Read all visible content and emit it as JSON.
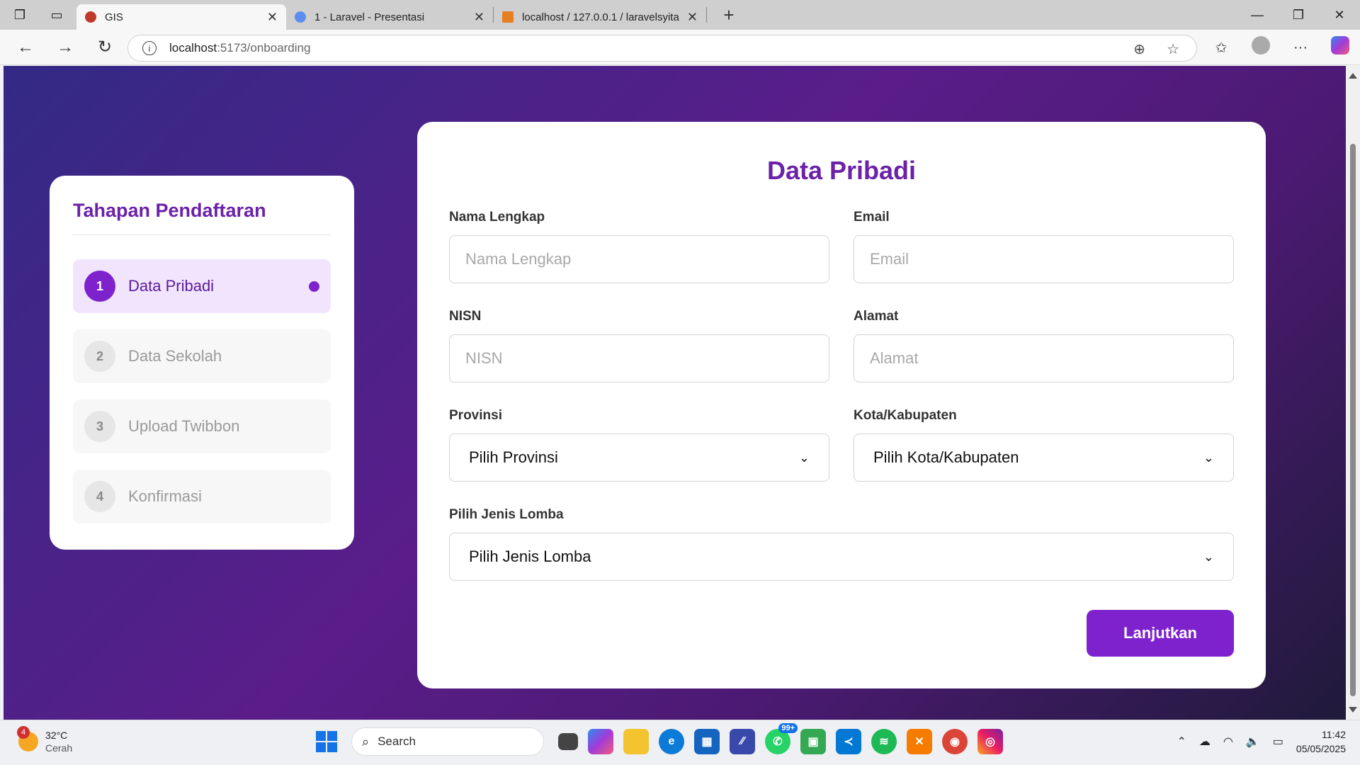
{
  "browser": {
    "tabs": [
      {
        "title": "GIS",
        "active": true,
        "favicon_color": "#c0392b"
      },
      {
        "title": "1 - Laravel - Presentasi",
        "active": false,
        "favicon_color": "#5b8def"
      },
      {
        "title": "localhost / 127.0.0.1 / laravelsyita",
        "active": false,
        "favicon_color": "#e67e22"
      }
    ],
    "new_tab": "+",
    "url_host": "localhost",
    "url_path": ":5173/onboarding"
  },
  "sidebar": {
    "title": "Tahapan Pendaftaran",
    "steps": [
      {
        "num": "1",
        "label": "Data Pribadi"
      },
      {
        "num": "2",
        "label": "Data Sekolah"
      },
      {
        "num": "3",
        "label": "Upload Twibbon"
      },
      {
        "num": "4",
        "label": "Konfirmasi"
      }
    ],
    "active_step": 1
  },
  "form": {
    "title": "Data Pribadi",
    "nama": {
      "label": "Nama Lengkap",
      "placeholder": "Nama Lengkap",
      "value": ""
    },
    "email": {
      "label": "Email",
      "placeholder": "Email",
      "value": ""
    },
    "nisn": {
      "label": "NISN",
      "placeholder": "NISN",
      "value": ""
    },
    "alamat": {
      "label": "Alamat",
      "placeholder": "Alamat",
      "value": ""
    },
    "provinsi": {
      "label": "Provinsi",
      "selected": "Pilih Provinsi"
    },
    "kota": {
      "label": "Kota/Kabupaten",
      "selected": "Pilih Kota/Kabupaten"
    },
    "lomba": {
      "label": "Pilih Jenis Lomba",
      "selected": "Pilih Jenis Lomba"
    },
    "submit": "Lanjutkan"
  },
  "taskbar": {
    "weather_badge": "4",
    "temperature": "32°C",
    "condition": "Cerah",
    "search": "Search",
    "whatsapp_badge": "99+",
    "time": "11:42",
    "date": "05/05/2025"
  },
  "colors": {
    "accent": "#7e22ce",
    "title": "#6b21a8",
    "active_step_bg": "#f1e4fd"
  }
}
